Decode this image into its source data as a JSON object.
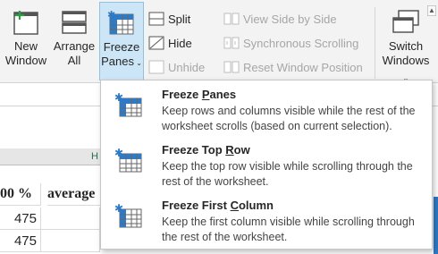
{
  "ribbon": {
    "new_window": [
      "New",
      "Window"
    ],
    "arrange_all": [
      "Arrange",
      "All"
    ],
    "freeze_panes": [
      "Freeze",
      "Panes"
    ],
    "split": "Split",
    "hide": "Hide",
    "unhide": "Unhide",
    "view_side_by_side": "View Side by Side",
    "synchronous_scrolling": "Synchronous Scrolling",
    "reset_window_position": "Reset Window Position",
    "switch_windows": [
      "Switch",
      "Windows"
    ]
  },
  "sheet": {
    "col_letter": "H",
    "header_left": "00 %",
    "header_mid": "average",
    "values": [
      "475",
      "475"
    ]
  },
  "menu": {
    "items": [
      {
        "title": "Freeze Panes",
        "underline": "P",
        "desc": "Keep rows and columns visible while the rest of the worksheet scrolls (based on current selection)."
      },
      {
        "title": "Freeze Top Row",
        "underline": "R",
        "desc": "Keep the top row visible while scrolling through the rest of the worksheet."
      },
      {
        "title": "Freeze First Column",
        "underline": "C",
        "desc": "Keep the first column visible while scrolling through the rest of the worksheet."
      }
    ]
  },
  "colors": {
    "accent": "#2f79c5",
    "highlight": "#cde6f7",
    "disabled": "#a6a6a6"
  }
}
